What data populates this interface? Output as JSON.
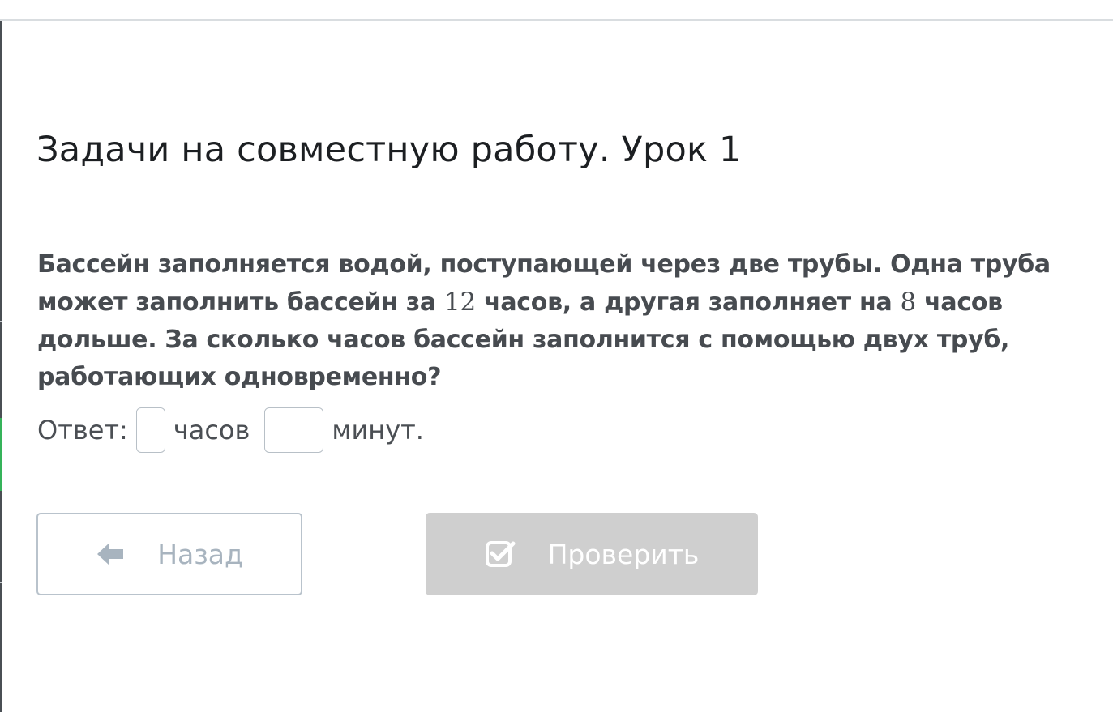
{
  "lesson": {
    "title": "Задачи на совместную работу. Урок 1"
  },
  "problem": {
    "part1": "Бассейн заполняется водой, поступающей через две трубы. Одна труба может заполнить бассейн за ",
    "num1": "12",
    "part2": " часов, а другая заполняет на ",
    "num2": "8",
    "part3": " часов дольше. За сколько часов бассейн заполнится с помощью двух труб, работающих одновременно?"
  },
  "answer": {
    "label": "Ответ:",
    "hours_value": "",
    "hours_unit": "часов",
    "minutes_value": "",
    "minutes_unit": "минут."
  },
  "buttons": {
    "back": {
      "label": "Назад",
      "icon": "arrow-left-icon"
    },
    "check": {
      "label": "Проверить",
      "icon": "check-square-icon"
    }
  },
  "colors": {
    "accent_green": "#35b35a",
    "check_button_disabled": "#cfcfcf",
    "back_button_border": "#b9c3cc"
  }
}
